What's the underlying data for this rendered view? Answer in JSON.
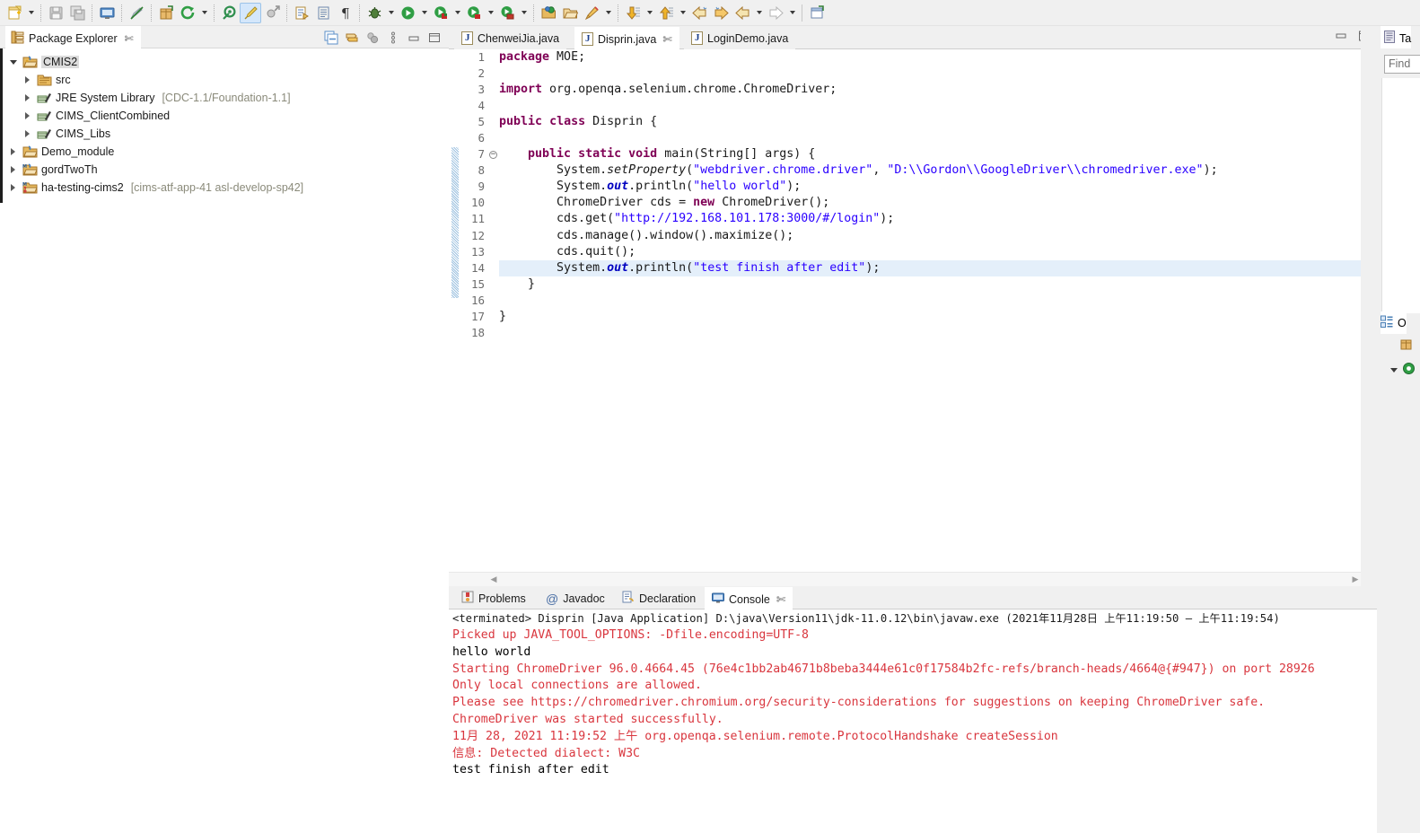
{
  "toolbar": {
    "items": [
      {
        "name": "new-wizard",
        "icon": "new-file-icon",
        "dropdown": true
      },
      {
        "name": "save",
        "icon": "save-icon",
        "dropdown": false
      },
      {
        "name": "save-all",
        "icon": "save-all-icon",
        "dropdown": false
      },
      {
        "name": "open-console",
        "icon": "console-icon",
        "dropdown": false
      },
      {
        "name": "toggle-annotations",
        "icon": "pencil-strike-icon",
        "dropdown": false
      },
      {
        "name": "new-package",
        "icon": "package-icon",
        "dropdown": false
      },
      {
        "name": "refresh",
        "icon": "refresh-icon",
        "dropdown": true
      },
      {
        "name": "new-java-project",
        "icon": "java-project-icon",
        "dropdown": false
      },
      {
        "name": "build",
        "icon": "build-brush-icon",
        "dropdown": false,
        "active": true
      },
      {
        "name": "external-tools",
        "icon": "run-external-icon",
        "dropdown": false
      },
      {
        "name": "open-task",
        "icon": "task-icon",
        "dropdown": false
      },
      {
        "name": "open-type",
        "icon": "open-type-icon",
        "dropdown": false
      },
      {
        "name": "paragraph-marks",
        "icon": "pilcrow-icon",
        "dropdown": false
      },
      {
        "name": "debug",
        "icon": "debug-bug-icon",
        "dropdown": true
      },
      {
        "name": "run",
        "icon": "run-play-icon",
        "dropdown": true
      },
      {
        "name": "coverage",
        "icon": "coverage-icon",
        "dropdown": true
      },
      {
        "name": "profile",
        "icon": "profile-icon",
        "dropdown": true
      },
      {
        "name": "run-last",
        "icon": "run-lock-icon",
        "dropdown": true
      },
      {
        "name": "open-resource",
        "icon": "open-folder-green-icon",
        "dropdown": false
      },
      {
        "name": "open-folder",
        "icon": "open-folder-icon",
        "dropdown": false
      },
      {
        "name": "new-marker",
        "icon": "pen-icon",
        "dropdown": true
      },
      {
        "name": "next-annotation",
        "icon": "down-arrow-icon",
        "dropdown": true
      },
      {
        "name": "previous-annotation",
        "icon": "up-arrow-icon",
        "dropdown": true
      },
      {
        "name": "back-history",
        "icon": "back-arrow-icon",
        "dropdown": false
      },
      {
        "name": "forward-history",
        "icon": "forward-arrow-icon",
        "dropdown": false
      },
      {
        "name": "previous-edit",
        "icon": "left-arrow-icon",
        "dropdown": true
      },
      {
        "name": "next-edit",
        "icon": "right-arrow-gray-icon",
        "dropdown": true
      },
      {
        "name": "new-window",
        "icon": "new-window-icon",
        "dropdown": false
      }
    ]
  },
  "package_explorer": {
    "title": "Package Explorer",
    "close_glyph": "✄",
    "tools": [
      {
        "name": "collapse-all-icon"
      },
      {
        "name": "link-with-editor-icon"
      },
      {
        "name": "focus-on-active-task-icon"
      },
      {
        "name": "view-menu-icon"
      },
      {
        "name": "minimize-icon"
      },
      {
        "name": "maximize-icon"
      }
    ],
    "tree": [
      {
        "label": "CMIS2",
        "sub": "",
        "indent": 0,
        "state": "open",
        "icon": "java-project-icon",
        "selected": true
      },
      {
        "label": "src",
        "sub": "",
        "indent": 1,
        "state": "closed",
        "icon": "source-folder-icon",
        "selected": false
      },
      {
        "label": "JRE System Library",
        "sub": "[CDC-1.1/Foundation-1.1]",
        "indent": 1,
        "state": "closed",
        "icon": "library-icon",
        "selected": false
      },
      {
        "label": "CIMS_ClientCombined",
        "sub": "",
        "indent": 1,
        "state": "closed",
        "icon": "library-icon",
        "selected": false
      },
      {
        "label": "CIMS_Libs",
        "sub": "",
        "indent": 1,
        "state": "closed",
        "icon": "library-icon",
        "selected": false
      },
      {
        "label": "Demo_module",
        "sub": "",
        "indent": 0,
        "state": "closed",
        "icon": "project-icon",
        "selected": false
      },
      {
        "label": "gordTwoTh",
        "sub": "",
        "indent": 0,
        "state": "closed",
        "icon": "maven-project-icon",
        "selected": false
      },
      {
        "label": "ha-testing-cims2",
        "sub": "[cims-atf-app-41 asl-develop-sp42]",
        "indent": 0,
        "state": "closed",
        "icon": "git-project-icon",
        "selected": false
      }
    ]
  },
  "editor": {
    "tabs": [
      {
        "label": "ChenweiJia.java",
        "active": false,
        "closeable": false
      },
      {
        "label": "Disprin.java",
        "active": true,
        "closeable": true
      },
      {
        "label": "LoginDemo.java",
        "active": false,
        "closeable": false
      }
    ],
    "close_glyph": "✄",
    "window_buttons": [
      {
        "name": "minimize-icon"
      },
      {
        "name": "maximize-icon"
      }
    ],
    "line_numbers": [
      "1",
      "2",
      "3",
      "4",
      "5",
      "6",
      "7",
      "8",
      "9",
      "10",
      "11",
      "12",
      "13",
      "14",
      "15",
      "16",
      "17",
      "18"
    ],
    "fold_marker_line": 7,
    "fold_marker_glyph": "−",
    "highlighted_line": 14,
    "lines": [
      {
        "n": 1,
        "tokens": [
          {
            "t": "package",
            "c": "kw"
          },
          {
            "t": " MOE;",
            "c": ""
          }
        ]
      },
      {
        "n": 2,
        "tokens": []
      },
      {
        "n": 3,
        "tokens": [
          {
            "t": "import",
            "c": "kw"
          },
          {
            "t": " org.openqa.selenium.chrome.ChromeDriver;",
            "c": ""
          }
        ]
      },
      {
        "n": 4,
        "tokens": []
      },
      {
        "n": 5,
        "tokens": [
          {
            "t": "public",
            "c": "kw"
          },
          {
            "t": " ",
            "c": ""
          },
          {
            "t": "class",
            "c": "kw"
          },
          {
            "t": " Disprin {",
            "c": ""
          }
        ]
      },
      {
        "n": 6,
        "tokens": []
      },
      {
        "n": 7,
        "tokens": [
          {
            "t": "    ",
            "c": ""
          },
          {
            "t": "public",
            "c": "kw"
          },
          {
            "t": " ",
            "c": ""
          },
          {
            "t": "static",
            "c": "kw"
          },
          {
            "t": " ",
            "c": ""
          },
          {
            "t": "void",
            "c": "kw"
          },
          {
            "t": " main(String[] args) {",
            "c": ""
          }
        ]
      },
      {
        "n": 8,
        "tokens": [
          {
            "t": "        System.",
            "c": ""
          },
          {
            "t": "setProperty",
            "c": "mtd"
          },
          {
            "t": "(",
            "c": ""
          },
          {
            "t": "\"webdriver.chrome.driver\"",
            "c": "str"
          },
          {
            "t": ", ",
            "c": ""
          },
          {
            "t": "\"D:\\\\Gordon\\\\GoogleDriver\\\\chromedriver.exe\"",
            "c": "str"
          },
          {
            "t": ");",
            "c": ""
          }
        ]
      },
      {
        "n": 9,
        "tokens": [
          {
            "t": "        System.",
            "c": ""
          },
          {
            "t": "out",
            "c": "fld"
          },
          {
            "t": ".println(",
            "c": ""
          },
          {
            "t": "\"hello world\"",
            "c": "str"
          },
          {
            "t": ");",
            "c": ""
          }
        ]
      },
      {
        "n": 10,
        "tokens": [
          {
            "t": "        ChromeDriver cds = ",
            "c": ""
          },
          {
            "t": "new",
            "c": "kw"
          },
          {
            "t": " ChromeDriver();",
            "c": ""
          }
        ]
      },
      {
        "n": 11,
        "tokens": [
          {
            "t": "        cds.get(",
            "c": ""
          },
          {
            "t": "\"http://192.168.101.178:3000/#/login\"",
            "c": "str"
          },
          {
            "t": ");",
            "c": ""
          }
        ]
      },
      {
        "n": 12,
        "tokens": [
          {
            "t": "        cds.manage().window().maximize();",
            "c": ""
          }
        ]
      },
      {
        "n": 13,
        "tokens": [
          {
            "t": "        cds.quit();",
            "c": ""
          }
        ]
      },
      {
        "n": 14,
        "tokens": [
          {
            "t": "        System.",
            "c": ""
          },
          {
            "t": "out",
            "c": "fld"
          },
          {
            "t": ".println(",
            "c": ""
          },
          {
            "t": "\"test finish after edit\"",
            "c": "str"
          },
          {
            "t": ");",
            "c": ""
          }
        ]
      },
      {
        "n": 15,
        "tokens": [
          {
            "t": "    }",
            "c": ""
          }
        ]
      },
      {
        "n": 16,
        "tokens": []
      },
      {
        "n": 17,
        "tokens": [
          {
            "t": "}",
            "c": ""
          }
        ]
      },
      {
        "n": 18,
        "tokens": []
      }
    ]
  },
  "console": {
    "tabs": [
      {
        "label": "Problems",
        "icon": "problems-icon",
        "active": false,
        "closeable": false
      },
      {
        "label": "Javadoc",
        "icon": "javadoc-at-icon",
        "active": false,
        "closeable": false
      },
      {
        "label": "Declaration",
        "icon": "declaration-icon",
        "active": false,
        "closeable": false
      },
      {
        "label": "Console",
        "icon": "console-monitor-icon",
        "active": true,
        "closeable": true
      }
    ],
    "close_glyph": "✄",
    "tools": [
      {
        "name": "maximize-icon"
      },
      {
        "name": "close-icon"
      }
    ],
    "header": "<terminated> Disprin [Java Application] D:\\java\\Version11\\jdk-11.0.12\\bin\\javaw.exe  (2021年11月28日 上午11:19:50 – 上午11:19:54)",
    "output": [
      {
        "text": "Picked up JAVA_TOOL_OPTIONS: -Dfile.encoding=UTF-8",
        "stream": "err"
      },
      {
        "text": "hello world",
        "stream": "out"
      },
      {
        "text": "Starting ChromeDriver 96.0.4664.45 (76e4c1bb2ab4671b8beba3444e61c0f17584b2fc-refs/branch-heads/4664@{#947}) on port 28926",
        "stream": "err"
      },
      {
        "text": "Only local connections are allowed.",
        "stream": "err"
      },
      {
        "text": "Please see https://chromedriver.chromium.org/security-considerations for suggestions on keeping ChromeDriver safe.",
        "stream": "err"
      },
      {
        "text": "ChromeDriver was started successfully.",
        "stream": "err"
      },
      {
        "text": "11月 28, 2021 11:19:52 上午 org.openqa.selenium.remote.ProtocolHandshake createSession",
        "stream": "err"
      },
      {
        "text": "信息: Detected dialect: W3C",
        "stream": "err"
      },
      {
        "text": "test finish after edit",
        "stream": "out"
      }
    ]
  },
  "right_panel": {
    "task_list_tab": "Ta",
    "find_placeholder": "Find",
    "outline_tab": "O"
  },
  "colors": {
    "keyword": "#7f0055",
    "string": "#2a00ff",
    "field": "#0000c0",
    "stderr": "#d9363e",
    "stdout": "#000000",
    "selection": "#e4effa",
    "chrome": "#f0f0f0"
  }
}
